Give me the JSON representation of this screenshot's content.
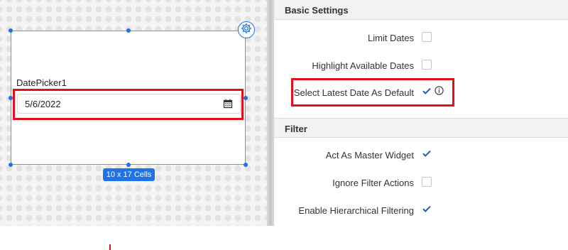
{
  "canvas": {
    "widget": {
      "title": "DatePicker1",
      "date_value": "5/6/2022",
      "size_label": "10 x 17 Cells"
    }
  },
  "panel": {
    "basic_settings": {
      "title": "Basic Settings",
      "options": [
        {
          "label": "Limit Dates",
          "checked": false
        },
        {
          "label": "Highlight Available Dates",
          "checked": false
        },
        {
          "label": "Select Latest Date As Default",
          "checked": true
        }
      ]
    },
    "filter": {
      "title": "Filter",
      "options": [
        {
          "label": "Act As Master Widget",
          "checked": true
        },
        {
          "label": "Ignore Filter Actions",
          "checked": false
        },
        {
          "label": "Enable Hierarchical Filtering",
          "checked": true
        }
      ]
    }
  },
  "colors": {
    "accent": "#1f73e8",
    "highlight": "#e0101c",
    "check": "#1f5fb5"
  },
  "icons": [
    "gear-icon",
    "calendar-icon",
    "check-icon",
    "info-icon"
  ]
}
